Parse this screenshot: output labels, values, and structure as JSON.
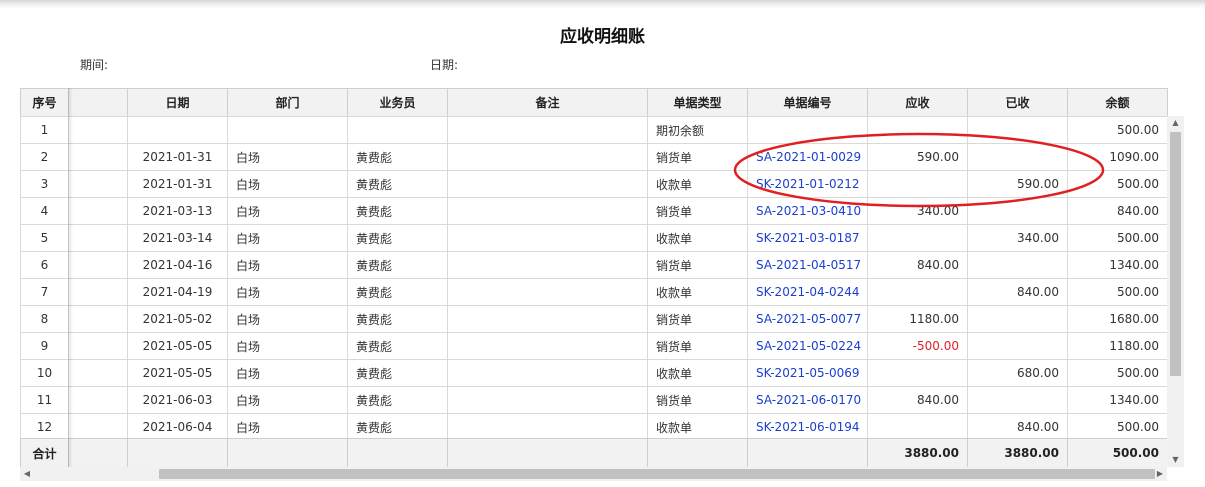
{
  "report": {
    "title": "应收明细账",
    "period_label": "期间:",
    "period_value": "",
    "date_label": "日期:",
    "date_value": ""
  },
  "columns": [
    "序号",
    "日期",
    "部门",
    "业务员",
    "备注",
    "单据类型",
    "单据编号",
    "应收",
    "已收",
    "余额"
  ],
  "rows": [
    {
      "no": "1",
      "date": "",
      "dept": "",
      "staff": "",
      "note": "",
      "type": "期初余额",
      "doc": "",
      "recv": "",
      "paid": "",
      "balance": "500.00"
    },
    {
      "no": "2",
      "date": "2021-01-31",
      "dept": "白场",
      "staff": "黄费彪",
      "note": "",
      "type": "销货单",
      "doc": "SA-2021-01-0029",
      "recv": "590.00",
      "paid": "",
      "balance": "1090.00"
    },
    {
      "no": "3",
      "date": "2021-01-31",
      "dept": "白场",
      "staff": "黄费彪",
      "note": "",
      "type": "收款单",
      "doc": "SK-2021-01-0212",
      "recv": "",
      "paid": "590.00",
      "balance": "500.00"
    },
    {
      "no": "4",
      "date": "2021-03-13",
      "dept": "白场",
      "staff": "黄费彪",
      "note": "",
      "type": "销货单",
      "doc": "SA-2021-03-0410",
      "recv": "340.00",
      "paid": "",
      "balance": "840.00"
    },
    {
      "no": "5",
      "date": "2021-03-14",
      "dept": "白场",
      "staff": "黄费彪",
      "note": "",
      "type": "收款单",
      "doc": "SK-2021-03-0187",
      "recv": "",
      "paid": "340.00",
      "balance": "500.00"
    },
    {
      "no": "6",
      "date": "2021-04-16",
      "dept": "白场",
      "staff": "黄费彪",
      "note": "",
      "type": "销货单",
      "doc": "SA-2021-04-0517",
      "recv": "840.00",
      "paid": "",
      "balance": "1340.00"
    },
    {
      "no": "7",
      "date": "2021-04-19",
      "dept": "白场",
      "staff": "黄费彪",
      "note": "",
      "type": "收款单",
      "doc": "SK-2021-04-0244",
      "recv": "",
      "paid": "840.00",
      "balance": "500.00"
    },
    {
      "no": "8",
      "date": "2021-05-02",
      "dept": "白场",
      "staff": "黄费彪",
      "note": "",
      "type": "销货单",
      "doc": "SA-2021-05-0077",
      "recv": "1180.00",
      "paid": "",
      "balance": "1680.00"
    },
    {
      "no": "9",
      "date": "2021-05-05",
      "dept": "白场",
      "staff": "黄费彪",
      "note": "",
      "type": "销货单",
      "doc": "SA-2021-05-0224",
      "recv": "-500.00",
      "paid": "",
      "balance": "1180.00"
    },
    {
      "no": "10",
      "date": "2021-05-05",
      "dept": "白场",
      "staff": "黄费彪",
      "note": "",
      "type": "收款单",
      "doc": "SK-2021-05-0069",
      "recv": "",
      "paid": "680.00",
      "balance": "500.00"
    },
    {
      "no": "11",
      "date": "2021-06-03",
      "dept": "白场",
      "staff": "黄费彪",
      "note": "",
      "type": "销货单",
      "doc": "SA-2021-06-0170",
      "recv": "840.00",
      "paid": "",
      "balance": "1340.00"
    },
    {
      "no": "12",
      "date": "2021-06-04",
      "dept": "白场",
      "staff": "黄费彪",
      "note": "",
      "type": "收款单",
      "doc": "SK-2021-06-0194",
      "recv": "",
      "paid": "840.00",
      "balance": "500.00"
    }
  ],
  "totals": {
    "label": "合计",
    "recv": "3880.00",
    "paid": "3880.00",
    "balance": "500.00"
  },
  "colors": {
    "link": "#1a3fd0",
    "negative": "#e0202a",
    "annotation": "#e02020",
    "header_bg": "#f2f2f2"
  },
  "icons": {
    "scroll_up": "arrow-up-icon",
    "scroll_down": "arrow-down-icon",
    "scroll_left": "arrow-left-icon",
    "scroll_right": "arrow-right-icon"
  }
}
